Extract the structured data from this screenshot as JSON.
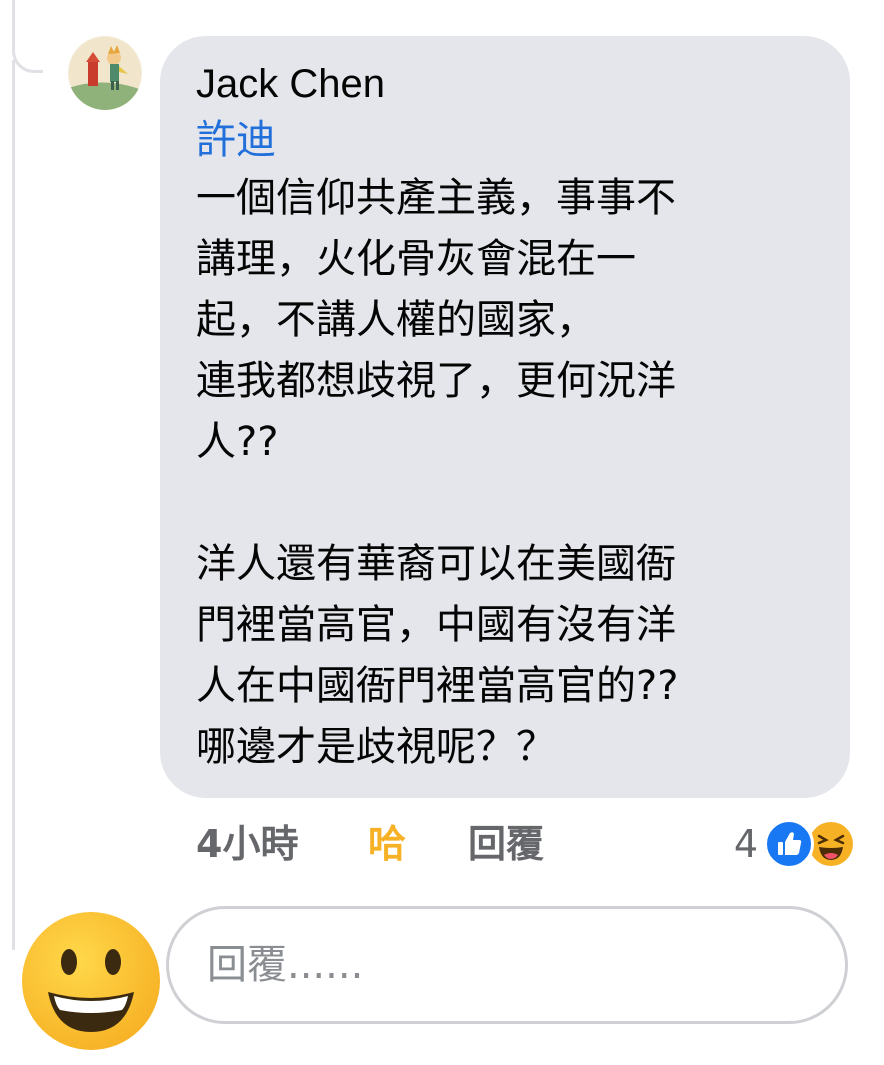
{
  "comment": {
    "author": "Jack Chen",
    "mention": "許迪",
    "lines": [
      "一個信仰共產主義，事事不",
      "講理，火化骨灰會混在一",
      "起，不講人權的國家，",
      "連我都想歧視了，更何況洋",
      "人??",
      "",
      "洋人還有華裔可以在美國衙",
      "門裡當高官，中國有沒有洋",
      "人在中國衙門裡當高官的??",
      "哪邊才是歧視呢？？"
    ]
  },
  "actions": {
    "time": "4小時",
    "reaction_label": "哈",
    "reply_label": "回覆"
  },
  "reactions": {
    "count": "4",
    "icons": [
      "like-icon",
      "haha-icon"
    ],
    "like_color": "#1877f2",
    "haha_color": "#f7b125"
  },
  "reply_box": {
    "placeholder": "回覆......"
  },
  "colors": {
    "bubble": "#e4e6eb",
    "mention": "#216fdb",
    "text": "#050505",
    "meta": "#65676b"
  }
}
